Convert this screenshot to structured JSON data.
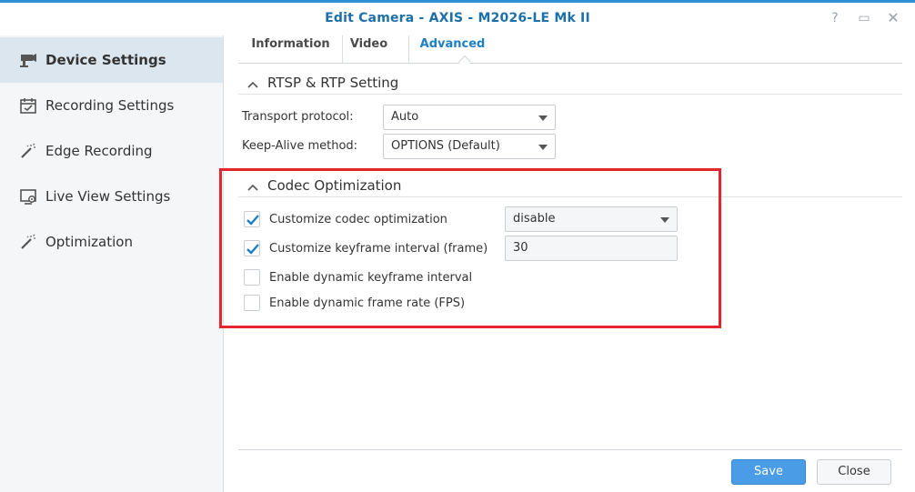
{
  "window": {
    "title": "Edit Camera - AXIS - M2026-LE Mk II",
    "help_glyph": "?",
    "maximize_glyph": "▭",
    "close_glyph": "✕"
  },
  "sidebar": {
    "items": [
      {
        "label": "Device Settings",
        "icon": "camera-icon",
        "active": true
      },
      {
        "label": "Recording Settings",
        "icon": "calendar-icon",
        "active": false
      },
      {
        "label": "Edge Recording",
        "icon": "magic-wand-icon",
        "active": false
      },
      {
        "label": "Live View Settings",
        "icon": "monitor-settings-icon",
        "active": false
      },
      {
        "label": "Optimization",
        "icon": "magic-wand-icon",
        "active": false
      }
    ]
  },
  "tabs": [
    {
      "label": "Information",
      "active": false
    },
    {
      "label": "Video",
      "active": false
    },
    {
      "label": "Advanced",
      "active": true
    }
  ],
  "rtsp": {
    "section_title": "RTSP & RTP Setting",
    "transport_label": "Transport protocol:",
    "transport_value": "Auto",
    "keepalive_label": "Keep-Alive method:",
    "keepalive_value": "OPTIONS (Default)"
  },
  "codec": {
    "section_title": "Codec Optimization",
    "options": [
      {
        "label": "Customize codec optimization",
        "checked": true
      },
      {
        "label": "Customize keyframe interval (frame)",
        "checked": true
      },
      {
        "label": "Enable dynamic keyframe interval",
        "checked": false
      },
      {
        "label": "Enable dynamic frame rate (FPS)",
        "checked": false
      }
    ],
    "codec_select_value": "disable",
    "keyframe_value": "30"
  },
  "footer": {
    "save_label": "Save",
    "close_label": "Close"
  },
  "colors": {
    "accent": "#2e8fd6",
    "title": "#1d6fa8",
    "highlight": "#e3262d",
    "check": "#1d7fc4",
    "save_button": "#4a9ce6"
  }
}
